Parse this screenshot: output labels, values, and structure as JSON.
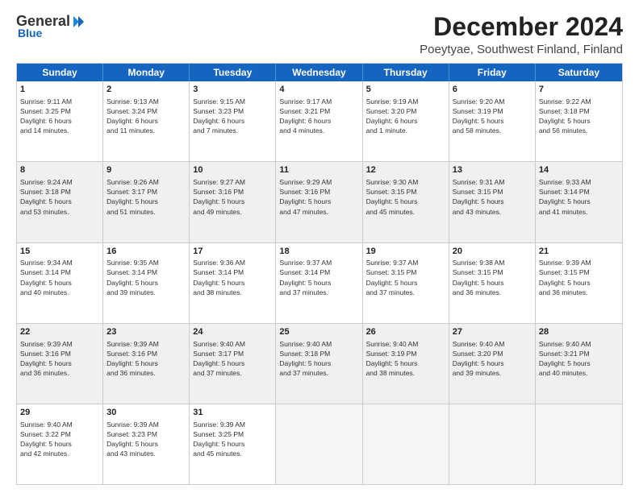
{
  "logo": {
    "general": "General",
    "blue": "Blue"
  },
  "title": "December 2024",
  "subtitle": "Poeytyae, Southwest Finland, Finland",
  "header_days": [
    "Sunday",
    "Monday",
    "Tuesday",
    "Wednesday",
    "Thursday",
    "Friday",
    "Saturday"
  ],
  "rows": [
    [
      {
        "day": "1",
        "text": "Sunrise: 9:11 AM\nSunset: 3:25 PM\nDaylight: 6 hours\nand 14 minutes.",
        "empty": false,
        "shaded": false
      },
      {
        "day": "2",
        "text": "Sunrise: 9:13 AM\nSunset: 3:24 PM\nDaylight: 6 hours\nand 11 minutes.",
        "empty": false,
        "shaded": false
      },
      {
        "day": "3",
        "text": "Sunrise: 9:15 AM\nSunset: 3:23 PM\nDaylight: 6 hours\nand 7 minutes.",
        "empty": false,
        "shaded": false
      },
      {
        "day": "4",
        "text": "Sunrise: 9:17 AM\nSunset: 3:21 PM\nDaylight: 6 hours\nand 4 minutes.",
        "empty": false,
        "shaded": false
      },
      {
        "day": "5",
        "text": "Sunrise: 9:19 AM\nSunset: 3:20 PM\nDaylight: 6 hours\nand 1 minute.",
        "empty": false,
        "shaded": false
      },
      {
        "day": "6",
        "text": "Sunrise: 9:20 AM\nSunset: 3:19 PM\nDaylight: 5 hours\nand 58 minutes.",
        "empty": false,
        "shaded": false
      },
      {
        "day": "7",
        "text": "Sunrise: 9:22 AM\nSunset: 3:18 PM\nDaylight: 5 hours\nand 56 minutes.",
        "empty": false,
        "shaded": false
      }
    ],
    [
      {
        "day": "8",
        "text": "Sunrise: 9:24 AM\nSunset: 3:18 PM\nDaylight: 5 hours\nand 53 minutes.",
        "empty": false,
        "shaded": true
      },
      {
        "day": "9",
        "text": "Sunrise: 9:26 AM\nSunset: 3:17 PM\nDaylight: 5 hours\nand 51 minutes.",
        "empty": false,
        "shaded": true
      },
      {
        "day": "10",
        "text": "Sunrise: 9:27 AM\nSunset: 3:16 PM\nDaylight: 5 hours\nand 49 minutes.",
        "empty": false,
        "shaded": true
      },
      {
        "day": "11",
        "text": "Sunrise: 9:29 AM\nSunset: 3:16 PM\nDaylight: 5 hours\nand 47 minutes.",
        "empty": false,
        "shaded": true
      },
      {
        "day": "12",
        "text": "Sunrise: 9:30 AM\nSunset: 3:15 PM\nDaylight: 5 hours\nand 45 minutes.",
        "empty": false,
        "shaded": true
      },
      {
        "day": "13",
        "text": "Sunrise: 9:31 AM\nSunset: 3:15 PM\nDaylight: 5 hours\nand 43 minutes.",
        "empty": false,
        "shaded": true
      },
      {
        "day": "14",
        "text": "Sunrise: 9:33 AM\nSunset: 3:14 PM\nDaylight: 5 hours\nand 41 minutes.",
        "empty": false,
        "shaded": true
      }
    ],
    [
      {
        "day": "15",
        "text": "Sunrise: 9:34 AM\nSunset: 3:14 PM\nDaylight: 5 hours\nand 40 minutes.",
        "empty": false,
        "shaded": false
      },
      {
        "day": "16",
        "text": "Sunrise: 9:35 AM\nSunset: 3:14 PM\nDaylight: 5 hours\nand 39 minutes.",
        "empty": false,
        "shaded": false
      },
      {
        "day": "17",
        "text": "Sunrise: 9:36 AM\nSunset: 3:14 PM\nDaylight: 5 hours\nand 38 minutes.",
        "empty": false,
        "shaded": false
      },
      {
        "day": "18",
        "text": "Sunrise: 9:37 AM\nSunset: 3:14 PM\nDaylight: 5 hours\nand 37 minutes.",
        "empty": false,
        "shaded": false
      },
      {
        "day": "19",
        "text": "Sunrise: 9:37 AM\nSunset: 3:15 PM\nDaylight: 5 hours\nand 37 minutes.",
        "empty": false,
        "shaded": false
      },
      {
        "day": "20",
        "text": "Sunrise: 9:38 AM\nSunset: 3:15 PM\nDaylight: 5 hours\nand 36 minutes.",
        "empty": false,
        "shaded": false
      },
      {
        "day": "21",
        "text": "Sunrise: 9:39 AM\nSunset: 3:15 PM\nDaylight: 5 hours\nand 36 minutes.",
        "empty": false,
        "shaded": false
      }
    ],
    [
      {
        "day": "22",
        "text": "Sunrise: 9:39 AM\nSunset: 3:16 PM\nDaylight: 5 hours\nand 36 minutes.",
        "empty": false,
        "shaded": true
      },
      {
        "day": "23",
        "text": "Sunrise: 9:39 AM\nSunset: 3:16 PM\nDaylight: 5 hours\nand 36 minutes.",
        "empty": false,
        "shaded": true
      },
      {
        "day": "24",
        "text": "Sunrise: 9:40 AM\nSunset: 3:17 PM\nDaylight: 5 hours\nand 37 minutes.",
        "empty": false,
        "shaded": true
      },
      {
        "day": "25",
        "text": "Sunrise: 9:40 AM\nSunset: 3:18 PM\nDaylight: 5 hours\nand 37 minutes.",
        "empty": false,
        "shaded": true
      },
      {
        "day": "26",
        "text": "Sunrise: 9:40 AM\nSunset: 3:19 PM\nDaylight: 5 hours\nand 38 minutes.",
        "empty": false,
        "shaded": true
      },
      {
        "day": "27",
        "text": "Sunrise: 9:40 AM\nSunset: 3:20 PM\nDaylight: 5 hours\nand 39 minutes.",
        "empty": false,
        "shaded": true
      },
      {
        "day": "28",
        "text": "Sunrise: 9:40 AM\nSunset: 3:21 PM\nDaylight: 5 hours\nand 40 minutes.",
        "empty": false,
        "shaded": true
      }
    ],
    [
      {
        "day": "29",
        "text": "Sunrise: 9:40 AM\nSunset: 3:22 PM\nDaylight: 5 hours\nand 42 minutes.",
        "empty": false,
        "shaded": false
      },
      {
        "day": "30",
        "text": "Sunrise: 9:39 AM\nSunset: 3:23 PM\nDaylight: 5 hours\nand 43 minutes.",
        "empty": false,
        "shaded": false
      },
      {
        "day": "31",
        "text": "Sunrise: 9:39 AM\nSunset: 3:25 PM\nDaylight: 5 hours\nand 45 minutes.",
        "empty": false,
        "shaded": false
      },
      {
        "day": "",
        "text": "",
        "empty": true,
        "shaded": false
      },
      {
        "day": "",
        "text": "",
        "empty": true,
        "shaded": false
      },
      {
        "day": "",
        "text": "",
        "empty": true,
        "shaded": false
      },
      {
        "day": "",
        "text": "",
        "empty": true,
        "shaded": false
      }
    ]
  ]
}
